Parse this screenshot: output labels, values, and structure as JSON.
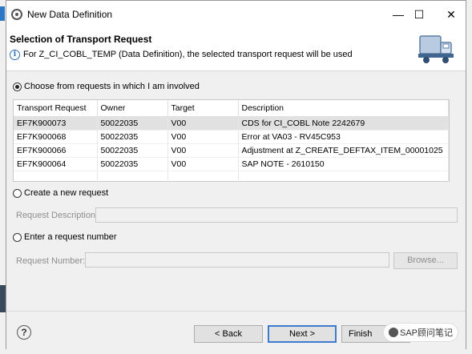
{
  "window": {
    "title": "New Data Definition",
    "minimize": "—",
    "maximize": "☐",
    "close": "✕"
  },
  "header": {
    "title": "Selection of Transport Request",
    "message": "For Z_CI_COBL_TEMP (Data Definition), the selected transport request will be used",
    "info_icon": "info-icon",
    "image_icon": "truck-icon"
  },
  "options": {
    "choose_label": "Choose from requests in which I am involved",
    "create_label": "Create a new request",
    "enter_label": "Enter a request number",
    "selected": "choose"
  },
  "table": {
    "columns": [
      "Transport Request",
      "Owner",
      "Target",
      "Description"
    ],
    "rows": [
      [
        "EF7K900073",
        "50022035",
        "V00",
        "CDS for CI_COBL Note 2242679"
      ],
      [
        "EF7K900068",
        "50022035",
        "V00",
        "Error at VA03 - RV45C953"
      ],
      [
        "EF7K900066",
        "50022035",
        "V00",
        "Adjustment at Z_CREATE_DEFTAX_ITEM_00001025"
      ],
      [
        "EF7K900064",
        "50022035",
        "V00",
        "SAP NOTE - 2610150"
      ]
    ],
    "selected_row": 0
  },
  "fields": {
    "request_description_label": "Request Description:",
    "request_description_value": "",
    "request_number_label": "Request Number:",
    "request_number_value": "",
    "browse_label": "Browse..."
  },
  "footer": {
    "help": "?",
    "back": "< Back",
    "next": "Next >",
    "finish": "Finish",
    "watermark": "SAP顾问笔记"
  }
}
